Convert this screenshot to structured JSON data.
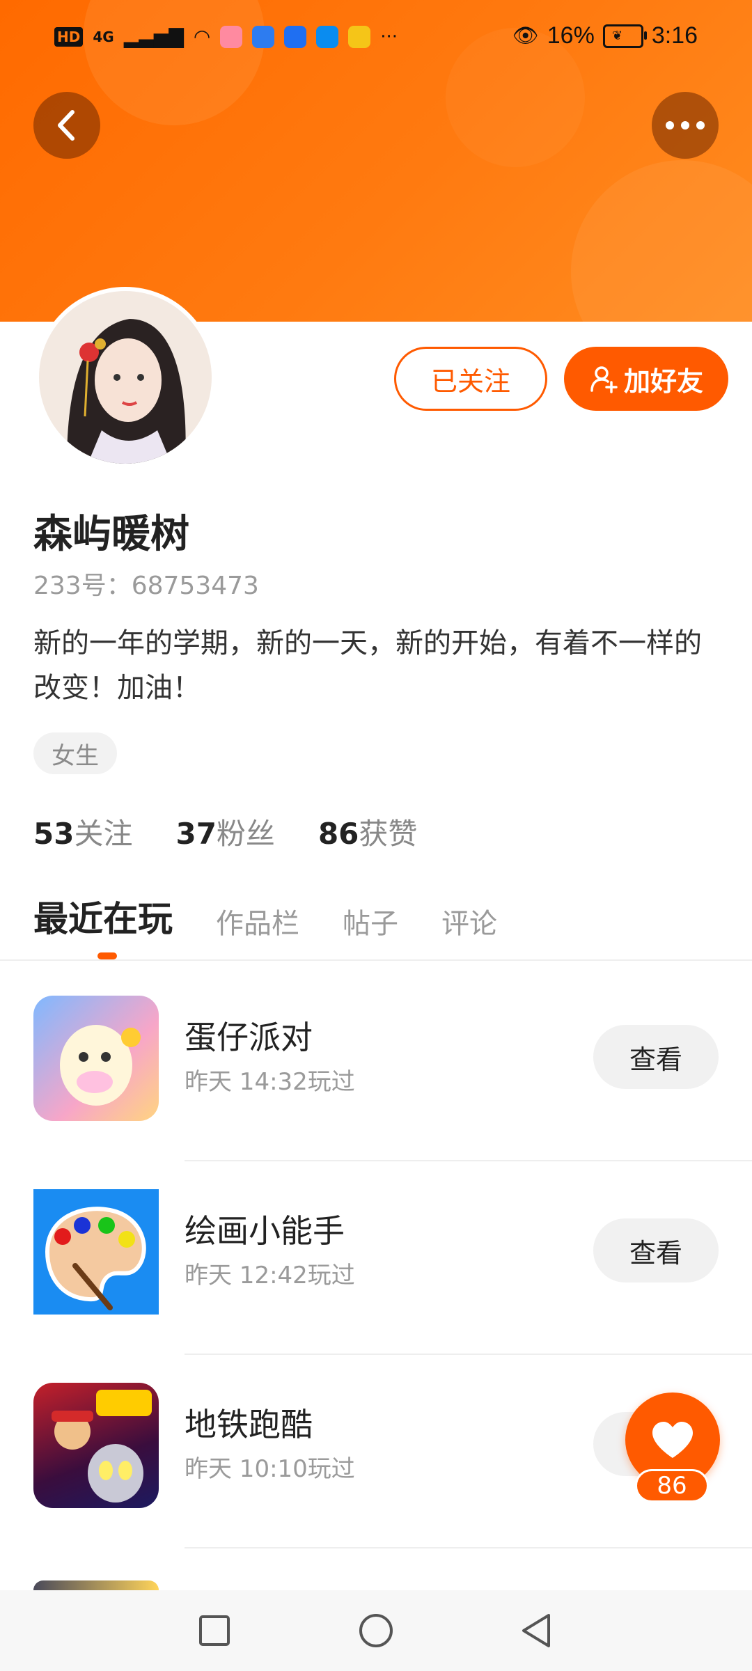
{
  "status_bar": {
    "left_text": "HD",
    "network": "4G",
    "eye_label": "👁",
    "battery_pct": "16%",
    "time": "3:16",
    "more": "···"
  },
  "profile": {
    "username": "森屿暖树",
    "id_text": "233号：68753473",
    "bio": "新的一年的学期，新的一天，新的开始，有着不一样的改变！加油！",
    "tag": "女生",
    "stats": [
      {
        "num": "53",
        "label": "关注"
      },
      {
        "num": "37",
        "label": "粉丝"
      },
      {
        "num": "86",
        "label": "获赞"
      }
    ]
  },
  "actions": {
    "followed_label": "已关注",
    "add_friend_label": "加好友"
  },
  "tabs": [
    {
      "label": "最近在玩",
      "active": true
    },
    {
      "label": "作品栏",
      "active": false
    },
    {
      "label": "帖子",
      "active": false
    },
    {
      "label": "评论",
      "active": false
    }
  ],
  "games": [
    {
      "name": "蛋仔派对",
      "time": "昨天 14:32玩过",
      "button": "查看",
      "icon": "eggy-party-icon"
    },
    {
      "name": "绘画小能手",
      "time": "昨天 12:42玩过",
      "button": "查看",
      "icon": "paint-palette-icon"
    },
    {
      "name": "地铁跑酷",
      "time": "昨天 10:10玩过",
      "button": "查看",
      "icon": "subway-surfers-icon"
    }
  ],
  "like_fab": {
    "count": "86",
    "icon": "heart-icon"
  },
  "colors": {
    "accent": "#ff5a00",
    "header": "#ff7a10"
  }
}
